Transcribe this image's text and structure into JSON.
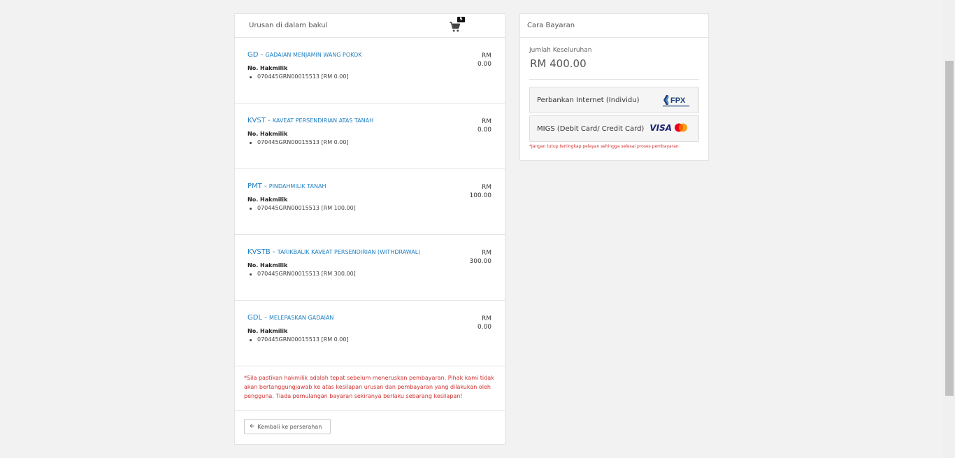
{
  "cart": {
    "title": "Urusan di dalam bakul",
    "badge_count": "5",
    "items": [
      {
        "code": "GD",
        "sep": " - ",
        "name": "GADAIAN MENJAMIN WANG POKOK",
        "label": "No. Hakmilik",
        "line": "070445GRN00015513 [RM 0.00]",
        "currency": "RM",
        "amount": "0.00"
      },
      {
        "code": "KVST",
        "sep": " - ",
        "name": "KAVEAT PERSENDIRIAN ATAS TANAH",
        "label": "No. Hakmilik",
        "line": "070445GRN00015513 [RM 0.00]",
        "currency": "RM",
        "amount": "0.00"
      },
      {
        "code": "PMT",
        "sep": " - ",
        "name": "PINDAHMILIK TANAH",
        "label": "No. Hakmilik",
        "line": "070445GRN00015513 [RM 100.00]",
        "currency": "RM",
        "amount": "100.00"
      },
      {
        "code": "KVSTB",
        "sep": " - ",
        "name": "TARIKBALIK KAVEAT PERSENDIRIAN (WITHDRAWAL)",
        "label": "No. Hakmilik",
        "line": "070445GRN00015513 [RM 300.00]",
        "currency": "RM",
        "amount": "300.00"
      },
      {
        "code": "GDL",
        "sep": " - ",
        "name": "MELEPASKAN GADAIAN",
        "label": "No. Hakmilik",
        "line": "070445GRN00015513 [RM 0.00]",
        "currency": "RM",
        "amount": "0.00"
      }
    ],
    "disclaimer": "*Sila pastikan hakmilik adalah tepat sebelum meneruskan pembayaran. Pihak kami tidak akan bertanggungjawab ke atas kesilapan urusan dan pembayaran yang dilakukan oleh pengguna. Tiada pemulangan bayaran sekiranya berlaku sebarang kesilapan!",
    "back_label": "Kembali ke perserahan"
  },
  "payment": {
    "title": "Cara Bayaran",
    "total_label": "Jumlah Keseluruhan",
    "total_value": "RM 400.00",
    "fpx_label": "Perbankan Internet (Individu)",
    "migs_label": "MIGS (Debit Card/ Credit Card)",
    "visa_text": "VISA",
    "warning": "*Jangan tutup tertingkap pelayan sehingga selesai proses pembayaran"
  },
  "colors": {
    "link": "#1e7fc3",
    "warning": "#d0302f"
  },
  "icons": {
    "cart": "cart-icon",
    "back": "arrow-left-icon",
    "fpx": "fpx-logo",
    "visa": "visa-logo",
    "mastercard": "mastercard-logo"
  }
}
